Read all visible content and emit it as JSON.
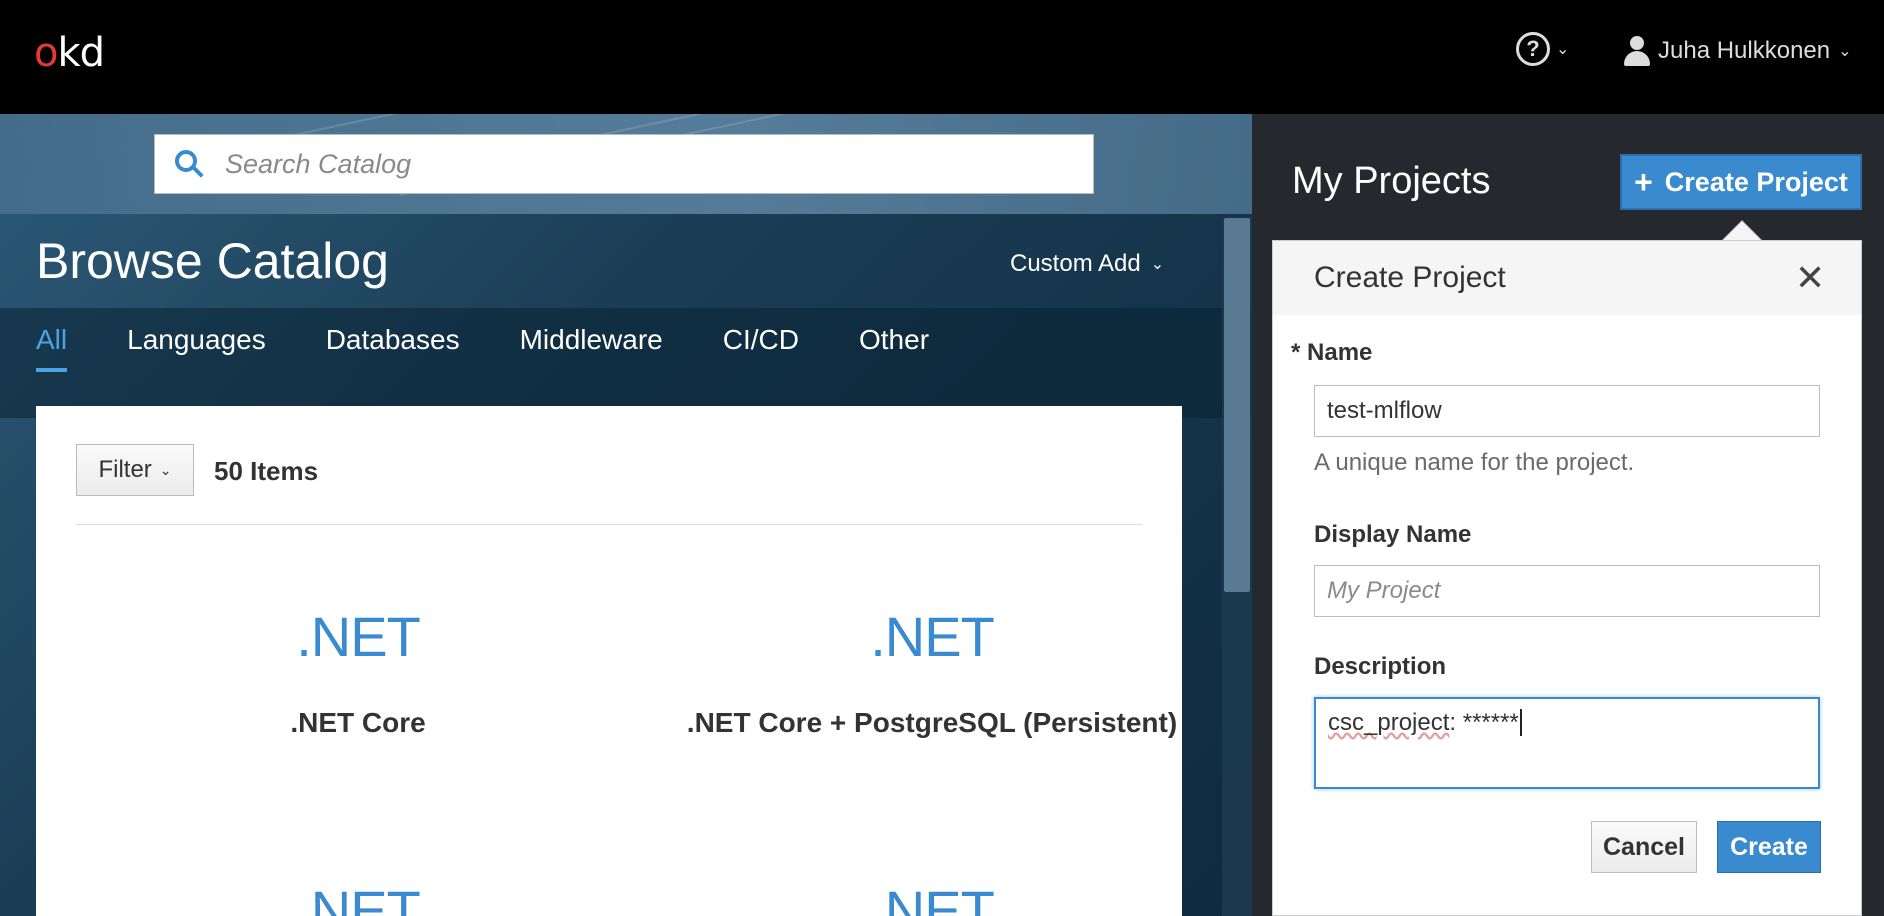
{
  "header": {
    "logo_first": "o",
    "logo_rest": "kd",
    "help_symbol": "?",
    "user_name": "Juha Hulkkonen"
  },
  "catalog": {
    "search_placeholder": "Search Catalog",
    "title": "Browse Catalog",
    "custom_add": "Custom Add",
    "tabs": [
      {
        "label": "All",
        "active": true
      },
      {
        "label": "Languages"
      },
      {
        "label": "Databases"
      },
      {
        "label": "Middleware"
      },
      {
        "label": "CI/CD"
      },
      {
        "label": "Other"
      }
    ],
    "filter_label": "Filter",
    "items_count": "50 Items",
    "cards": [
      {
        "logo_text": ".NET",
        "name": ".NET Core"
      },
      {
        "logo_text": ".NET",
        "name": ".NET Core + PostgreSQL (Persistent)"
      },
      {
        "logo_text": ".NET",
        "name": ""
      },
      {
        "logo_text": ".NET",
        "name": ""
      }
    ]
  },
  "projects": {
    "title": "My Projects",
    "create_button": "Create Project"
  },
  "create_dialog": {
    "title": "Create Project",
    "required_marker": "*",
    "name_label": "Name",
    "name_value": "test-mlflow",
    "name_help": "A unique name for the project.",
    "display_name_label": "Display Name",
    "display_name_placeholder": "My Project",
    "description_label": "Description",
    "description_key": "csc_project",
    "description_rest": ": ******",
    "cancel_label": "Cancel",
    "create_label": "Create"
  },
  "colors": {
    "accent": "#3a8ad0",
    "active_tab": "#4ba3e6",
    "logo_red": "#e03b3b"
  }
}
